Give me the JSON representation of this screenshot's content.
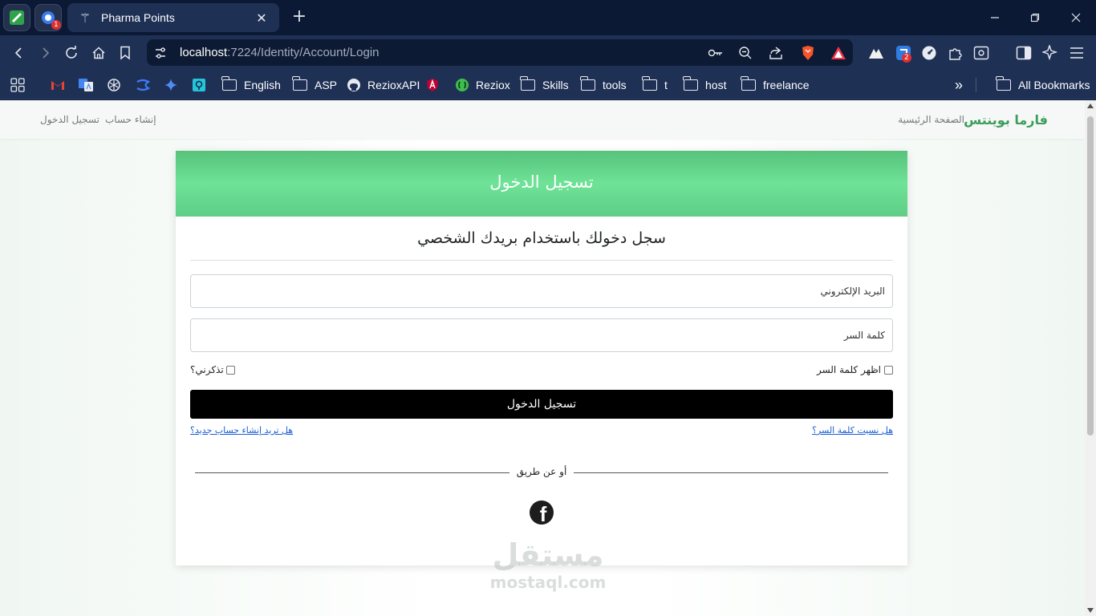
{
  "browser": {
    "tab_title": "Pharma Points",
    "new_tab_symbol": "+",
    "url_host": "localhost",
    "url_rest": ":7224/Identity/Account/Login",
    "pinned_badge": "1",
    "ext_badge": "2",
    "bookmarks": [
      {
        "label": "English",
        "icon": "folder-icon"
      },
      {
        "label": "ASP",
        "icon": "folder-icon"
      },
      {
        "label": "RezioxAPI",
        "icon": "github-icon"
      },
      {
        "label": "Reziox",
        "icon": "reziox-icon"
      },
      {
        "label": "Skills",
        "icon": "folder-icon"
      },
      {
        "label": "tools",
        "icon": "folder-icon"
      },
      {
        "label": "t",
        "icon": "folder-icon"
      },
      {
        "label": "host",
        "icon": "folder-icon"
      },
      {
        "label": "freelance",
        "icon": "folder-icon"
      }
    ],
    "all_bookmarks": "All Bookmarks",
    "more_symbol": "»"
  },
  "site": {
    "brand": "فارما بوينتس",
    "nav_home": "الصفحة الرئيسية",
    "nav_register": "إنشاء حساب",
    "nav_login": "تسجيل الدخول"
  },
  "login": {
    "header": "تسجيل الدخول",
    "subtitle": "سجل دخولك باستخدام بريدك الشخصي",
    "email_placeholder": "البريد الإلكتروني",
    "password_placeholder": "كلمة السر",
    "show_password": "اظهر كلمة السر",
    "remember_me": "تذكرني؟",
    "submit": "تسجيل الدخول",
    "forgot_password": "هل نسيت كلمة السر؟",
    "create_account": "هل تريد إنشاء حساب جديد؟",
    "or_via": "أو عن طريق",
    "facebook_glyph": "f"
  },
  "watermark": {
    "arabic": "مستقل",
    "latin": "mostaql.com"
  },
  "colors": {
    "header_green": "#6ee397",
    "brand_green": "#3c9d5b",
    "chrome_dark": "#0c1935",
    "chrome_toolbar": "#1f3055",
    "link_blue": "#1a5fd6"
  }
}
